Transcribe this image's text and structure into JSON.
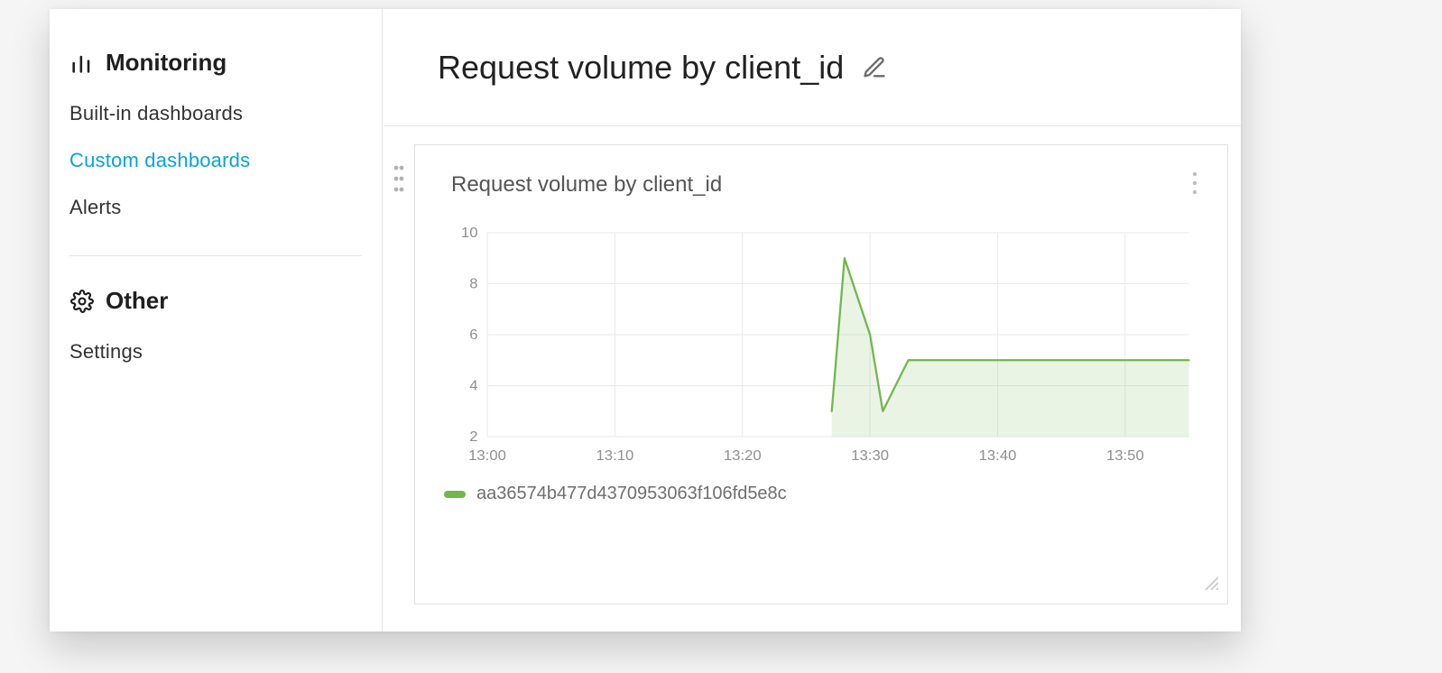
{
  "sidebar": {
    "section1": {
      "title": "Monitoring"
    },
    "items": [
      {
        "label": "Built-in dashboards",
        "active": false
      },
      {
        "label": "Custom dashboards",
        "active": true
      },
      {
        "label": "Alerts",
        "active": false
      }
    ],
    "section2": {
      "title": "Other"
    },
    "items2": [
      {
        "label": "Settings",
        "active": false
      }
    ]
  },
  "header": {
    "title": "Request volume by client_id"
  },
  "card": {
    "title": "Request volume by client_id"
  },
  "legend": {
    "series": "aa36574b477d4370953063f106fd5e8c",
    "color": "#72b74e"
  },
  "chart_data": {
    "type": "area",
    "title": "Request volume by client_id",
    "x_ticks": [
      "13:00",
      "13:10",
      "13:20",
      "13:30",
      "13:40",
      "13:50"
    ],
    "y_ticks": [
      2,
      4,
      6,
      8,
      10
    ],
    "xlim": [
      0,
      55
    ],
    "ylim": [
      2,
      10
    ],
    "xlabel": "",
    "ylabel": "",
    "grid": true,
    "legend_position": "bottom-left",
    "series": [
      {
        "name": "aa36574b477d4370953063f106fd5e8c",
        "color": "#72b74e",
        "fill": "rgba(114,183,78,0.15)",
        "points": [
          {
            "x": 27,
            "y": 3
          },
          {
            "x": 28,
            "y": 9
          },
          {
            "x": 30,
            "y": 6
          },
          {
            "x": 31,
            "y": 3
          },
          {
            "x": 33,
            "y": 5
          },
          {
            "x": 55,
            "y": 5
          }
        ]
      }
    ]
  }
}
